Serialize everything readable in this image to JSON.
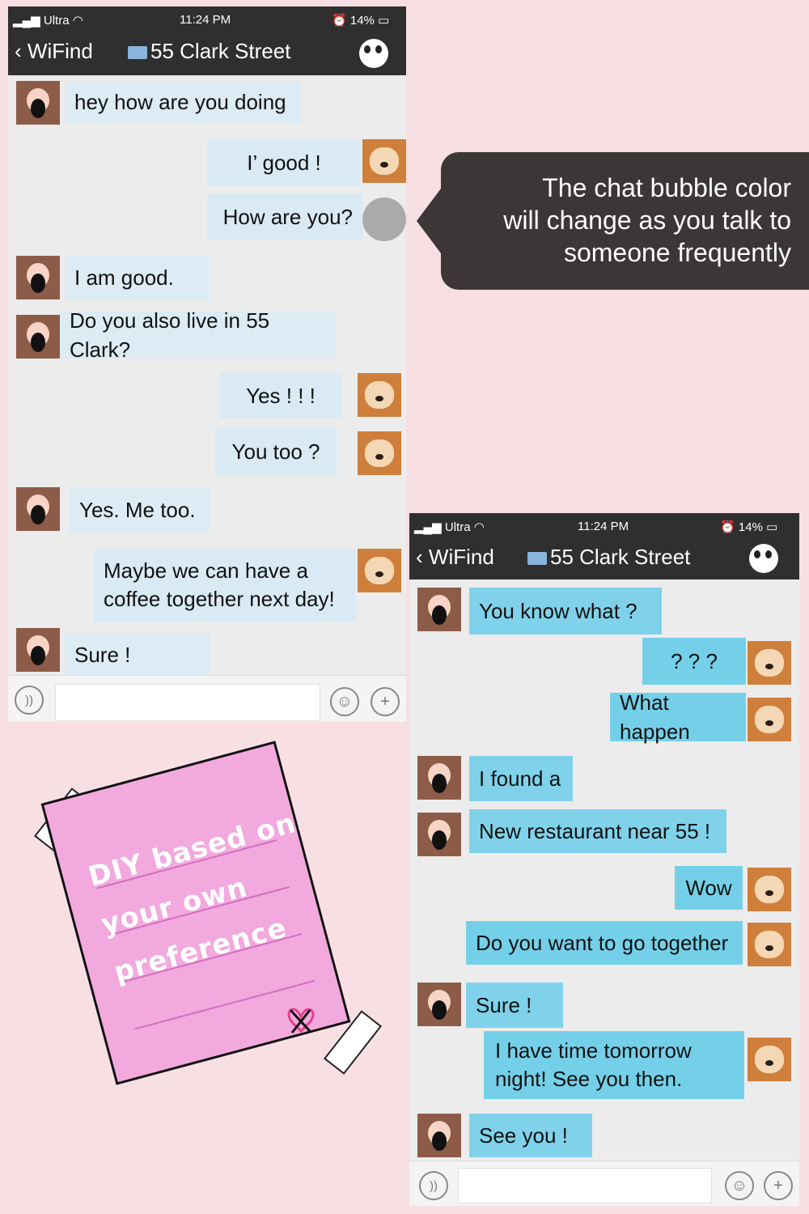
{
  "phone1": {
    "status": {
      "carrier": "Ultra",
      "time": "11:24 PM",
      "battery": "14%"
    },
    "nav": {
      "back": "WiFind",
      "title": "55 Clark Street"
    },
    "messages": [
      {
        "side": "left",
        "text": "hey how are you doing"
      },
      {
        "side": "right",
        "text": "I’ good !"
      },
      {
        "side": "right",
        "text": "How are you?"
      },
      {
        "side": "left",
        "text": "I am good."
      },
      {
        "side": "left",
        "text": "Do you also live in 55 Clark?"
      },
      {
        "side": "right",
        "text": "Yes ! ! !"
      },
      {
        "side": "right",
        "text": "You too ?"
      },
      {
        "side": "left",
        "text": "Yes. Me too."
      },
      {
        "side": "right",
        "text": "Maybe we can have a coffee together next day!"
      },
      {
        "side": "left",
        "text": "Sure !"
      }
    ]
  },
  "phone2": {
    "status": {
      "carrier": "Ultra",
      "time": "11:24 PM",
      "battery": "14%"
    },
    "nav": {
      "back": "WiFind",
      "title": "55 Clark Street"
    },
    "messages": [
      {
        "side": "left",
        "text": "You know what ?"
      },
      {
        "side": "right",
        "text": "? ? ?"
      },
      {
        "side": "right",
        "text": "What happen"
      },
      {
        "side": "left",
        "text": "I found a"
      },
      {
        "side": "left",
        "text": "New restaurant near 55 !"
      },
      {
        "side": "right",
        "text": "Wow"
      },
      {
        "side": "right",
        "text": "Do you want to go together"
      },
      {
        "side": "left",
        "text": "Sure !"
      },
      {
        "side": "right",
        "text": "I have time tomorrow night! See you then."
      },
      {
        "side": "left",
        "text": "See you !"
      }
    ]
  },
  "callout": {
    "text": "The chat bubble color will change as you talk to someone frequently"
  },
  "diy_note": {
    "line1": "DIY based on",
    "line2": "your own",
    "line3": "preference"
  },
  "icons": {
    "back": "chevron-left-icon",
    "signal": "signal-icon",
    "wifi": "wifi-icon",
    "alarm": "alarm-icon",
    "battery": "battery-icon",
    "menu": "panda-icon",
    "voice": "voice-icon",
    "emoji": "emoji-icon",
    "add": "plus-icon"
  },
  "colors": {
    "background": "#f7dfe4",
    "callout": "#3d3637",
    "bubble_light": "#dcebf4",
    "bubble_bright": "#7fd2ea",
    "note": "#f2a9de"
  }
}
